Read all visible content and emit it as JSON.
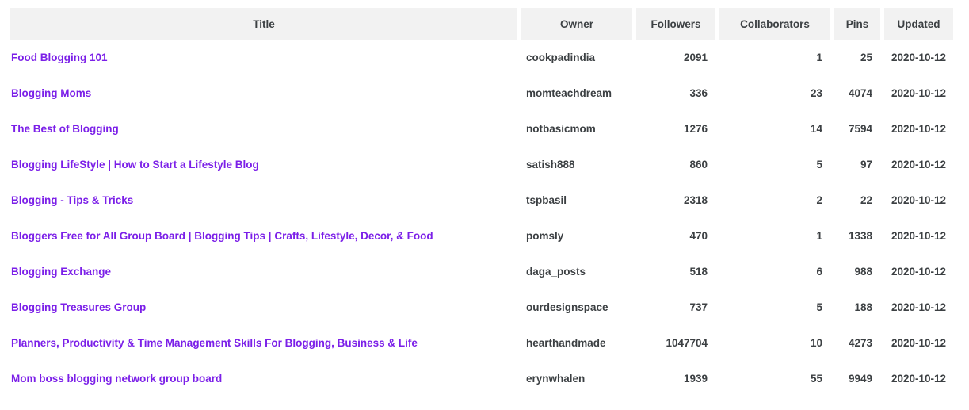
{
  "table": {
    "columns": [
      {
        "key": "title",
        "label": "Title",
        "align": "center"
      },
      {
        "key": "owner",
        "label": "Owner",
        "align": "center"
      },
      {
        "key": "followers",
        "label": "Followers",
        "align": "center"
      },
      {
        "key": "collaborators",
        "label": "Collaborators",
        "align": "center"
      },
      {
        "key": "pins",
        "label": "Pins",
        "align": "center"
      },
      {
        "key": "updated",
        "label": "Updated",
        "align": "center"
      }
    ],
    "rows": [
      {
        "title": "Food Blogging 101",
        "owner": "cookpadindia",
        "followers": "2091",
        "collaborators": "1",
        "pins": "25",
        "updated": "2020-10-12"
      },
      {
        "title": "Blogging Moms",
        "owner": "momteachdream",
        "followers": "336",
        "collaborators": "23",
        "pins": "4074",
        "updated": "2020-10-12"
      },
      {
        "title": "The Best of Blogging",
        "owner": "notbasicmom",
        "followers": "1276",
        "collaborators": "14",
        "pins": "7594",
        "updated": "2020-10-12"
      },
      {
        "title": "Blogging LifeStyle | How to Start a Lifestyle Blog",
        "owner": "satish888",
        "followers": "860",
        "collaborators": "5",
        "pins": "97",
        "updated": "2020-10-12"
      },
      {
        "title": "Blogging - Tips & Tricks",
        "owner": "tspbasil",
        "followers": "2318",
        "collaborators": "2",
        "pins": "22",
        "updated": "2020-10-12"
      },
      {
        "title": "Bloggers Free for All Group Board | Blogging Tips | Crafts, Lifestyle, Decor, & Food",
        "owner": "pomsly",
        "followers": "470",
        "collaborators": "1",
        "pins": "1338",
        "updated": "2020-10-12"
      },
      {
        "title": "Blogging Exchange",
        "owner": "daga_posts",
        "followers": "518",
        "collaborators": "6",
        "pins": "988",
        "updated": "2020-10-12"
      },
      {
        "title": "Blogging Treasures Group",
        "owner": "ourdesignspace",
        "followers": "737",
        "collaborators": "5",
        "pins": "188",
        "updated": "2020-10-12"
      },
      {
        "title": "Planners, Productivity & Time Management Skills For Blogging, Business & Life",
        "owner": "hearthandmade",
        "followers": "1047704",
        "collaborators": "10",
        "pins": "4273",
        "updated": "2020-10-12"
      },
      {
        "title": "Mom boss blogging network group board",
        "owner": "erynwhalen",
        "followers": "1939",
        "collaborators": "55",
        "pins": "9949",
        "updated": "2020-10-12"
      }
    ]
  },
  "colors": {
    "header_background": "#f2f2f2",
    "header_text": "#3c4043",
    "link": "#7B1FE8",
    "body_text": "#3c4043",
    "page_background": "#ffffff"
  }
}
